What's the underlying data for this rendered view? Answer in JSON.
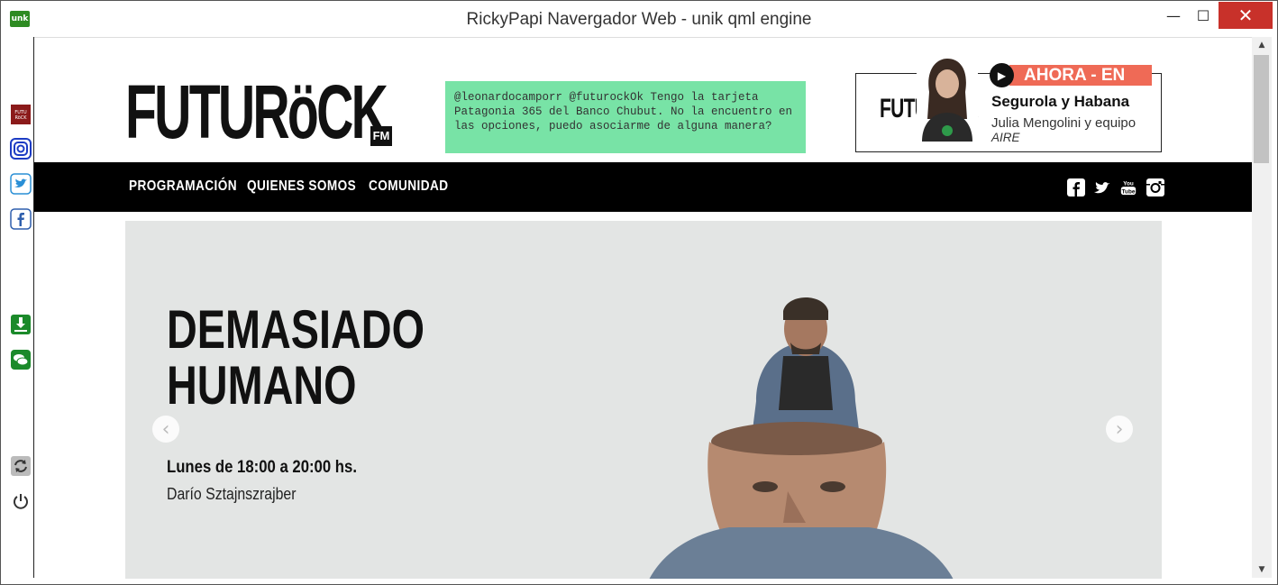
{
  "window": {
    "title": "RickyPapi Navergador Web - unik qml engine",
    "app_icon_label": "unk",
    "minimize_glyph": "—",
    "maximize_glyph": "☐",
    "close_glyph": "✕"
  },
  "sidebar": {
    "items": [
      {
        "name": "futurock-icon"
      },
      {
        "name": "instagram-icon"
      },
      {
        "name": "twitter-icon"
      },
      {
        "name": "facebook-icon"
      },
      {
        "name": "download-icon"
      },
      {
        "name": "chat-icon"
      },
      {
        "name": "refresh-icon"
      },
      {
        "name": "power-icon"
      }
    ]
  },
  "site": {
    "logo_text": "FUTURöCK",
    "logo_fm": "FM",
    "tweet": "@leonardocamporr @futurockOk Tengo la tarjeta Patagonia 365 del Banco Chubut. No la encuentro en las opciones, puedo asociarme de alguna manera?",
    "live": {
      "logo_text": "FUTURöCK",
      "badge": "AHORA - EN VIVO",
      "show": "Segurola y Habana",
      "hosts": "Julia Mengolini y equipo",
      "status": "AIRE"
    },
    "nav": {
      "items": [
        "PROGRAMACIÓN",
        "QUIENES SOMOS",
        "COMUNIDAD"
      ],
      "social": [
        "facebook-icon",
        "twitter-icon",
        "youtube-icon",
        "instagram-icon"
      ],
      "youtube_label": "You Tube"
    },
    "hero": {
      "title": "DEMASIADO\nHUMANO",
      "schedule": "Lunes de 18:00 a 20:00 hs.",
      "host": "Darío Sztajnszrajber"
    }
  },
  "colors": {
    "tweet_bg": "#78e3a6",
    "live_badge": "#ef6a56",
    "nav_bg": "#000000",
    "close_button": "#c8312a"
  }
}
